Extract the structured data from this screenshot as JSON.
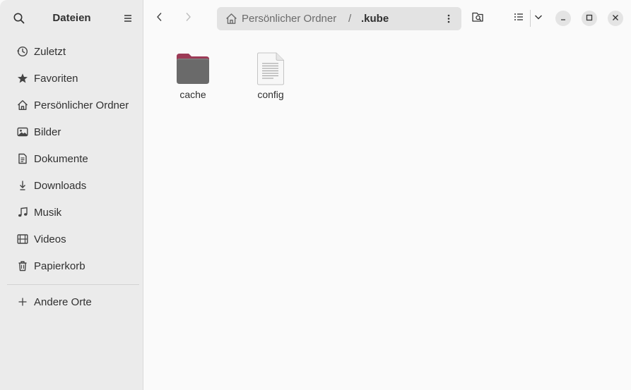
{
  "sidebar": {
    "title": "Dateien",
    "items": [
      {
        "label": "Zuletzt",
        "icon": "clock-icon"
      },
      {
        "label": "Favoriten",
        "icon": "star-icon"
      },
      {
        "label": "Persönlicher Ordner",
        "icon": "home-icon"
      },
      {
        "label": "Bilder",
        "icon": "image-icon"
      },
      {
        "label": "Dokumente",
        "icon": "document-icon"
      },
      {
        "label": "Downloads",
        "icon": "download-icon"
      },
      {
        "label": "Musik",
        "icon": "music-icon"
      },
      {
        "label": "Videos",
        "icon": "film-icon"
      },
      {
        "label": "Papierkorb",
        "icon": "trash-icon"
      }
    ],
    "other_locations": {
      "label": "Andere Orte",
      "icon": "plus-icon"
    }
  },
  "pathbar": {
    "segments": [
      "Persönlicher Ordner",
      ".kube"
    ],
    "separator": "/"
  },
  "files": [
    {
      "name": "cache",
      "type": "folder"
    },
    {
      "name": "config",
      "type": "text-document"
    }
  ],
  "colors": {
    "folder_top": "#9c3a56",
    "folder_body": "#6a6a6a",
    "sidebar_bg": "#ebebeb",
    "content_bg": "#fafafa"
  }
}
